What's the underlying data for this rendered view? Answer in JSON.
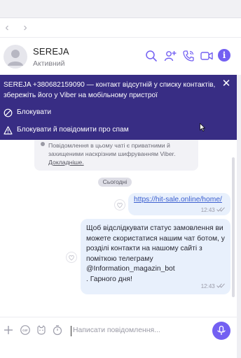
{
  "contact": {
    "name": "SEREJA",
    "status": "Активний"
  },
  "banner": {
    "text": "SEREJA +380682159090 — контакт відсутній у списку контактів, збережіть його у Viber на мобільному пристрої",
    "block_label": "Блокувати",
    "block_spam_label": "Блокувати й повідомити про спам"
  },
  "encryption": {
    "text": "Повідомлення в цьому чаті є приватними й захищеними наскрізним шифруванням Viber.",
    "link": "Докладніше."
  },
  "date_label": "Сьогодні",
  "messages": [
    {
      "text": "https://hit-sale.online/home/",
      "time": "12:43"
    },
    {
      "text": "Щоб відслідкувати статус замовлення ви можете скористатися нашим чат ботом, у розділі контакти на нашому сайті з поміткою телеграму @Information_magazin_bot\n. Гарного дня!",
      "time": "12:43"
    }
  ],
  "composer": {
    "placeholder": "Написати повідомлення..."
  },
  "colors": {
    "accent": "#7360f2",
    "banner_bg": "#382d84",
    "bubble_bg": "#e8f0fc"
  },
  "icons": {
    "header": [
      "search-icon",
      "add-contact-icon",
      "phone-icon",
      "video-icon",
      "info-icon"
    ],
    "composer": [
      "plus-icon",
      "gif-icon",
      "sticker-icon",
      "timer-icon",
      "microphone-icon"
    ]
  }
}
